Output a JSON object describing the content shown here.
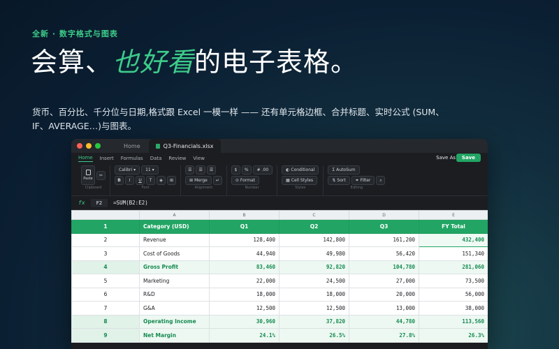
{
  "hero": {
    "kicker": "全新 · 数字格式与图表",
    "headline_prefix": "会算、",
    "headline_accent": "也好看",
    "headline_suffix": "的电子表格。",
    "description": "货币、百分比、千分位与日期,格式跟 Excel 一模一样 —— 还有单元格边框、合并标题、实时公式 (SUM、IF、AVERAGE…)与图表。"
  },
  "window": {
    "tab_home": "Home",
    "tab_file": "Q3-Financials.xlsx",
    "menus": [
      "Home",
      "Insert",
      "Formulas",
      "Data",
      "Review",
      "View"
    ],
    "save_as": "Save As",
    "save": "Save"
  },
  "ribbon": {
    "paste": "Paste",
    "clipboard": "Clipboard",
    "font_name": "Calibri ▾",
    "font_size": "11 ▾",
    "font_buttons": [
      "B",
      "I",
      "U",
      "T",
      "◈",
      "⊞"
    ],
    "font": "Font",
    "merge": "Merge",
    "alignment": "Alignment",
    "format": "Format",
    "number": "Number",
    "currency": "$",
    "percent": "%",
    "decimals": ".00",
    "conditional": "Conditional",
    "cell_styles": "Cell Styles",
    "styles": "Styles",
    "autosum": "AutoSum",
    "sort": "Sort",
    "filter": "Filter",
    "editing": "Editing"
  },
  "formula_bar": {
    "fx": "fx",
    "cell_ref": "F2",
    "formula": "=SUM(B2:E2)"
  },
  "sheet": {
    "columns": [
      "A",
      "B",
      "C",
      "D",
      "E"
    ],
    "rows": [
      {
        "n": "1",
        "cells": [
          "Category (USD)",
          "Q1",
          "Q2",
          "Q3",
          "FY Total"
        ]
      },
      {
        "n": "2",
        "cells": [
          "Revenue",
          "128,400",
          "142,800",
          "161,200",
          "432,400"
        ]
      },
      {
        "n": "3",
        "cells": [
          "Cost of Goods",
          "44,940",
          "49,980",
          "56,420",
          "151,340"
        ]
      },
      {
        "n": "4",
        "cells": [
          "Gross Profit",
          "83,460",
          "92,820",
          "104,780",
          "281,060"
        ]
      },
      {
        "n": "5",
        "cells": [
          "Marketing",
          "22,000",
          "24,500",
          "27,000",
          "73,500"
        ]
      },
      {
        "n": "6",
        "cells": [
          "R&D",
          "18,000",
          "18,000",
          "20,000",
          "56,000"
        ]
      },
      {
        "n": "7",
        "cells": [
          "G&A",
          "12,500",
          "12,500",
          "13,000",
          "38,000"
        ]
      },
      {
        "n": "8",
        "cells": [
          "Operating Income",
          "30,960",
          "37,820",
          "44,780",
          "113,560"
        ]
      },
      {
        "n": "9",
        "cells": [
          "Net Margin",
          "24.1%",
          "26.5%",
          "27.8%",
          "26.3%"
        ]
      }
    ]
  },
  "colors": {
    "accent": "#3dcc8a",
    "header_green": "#22a564",
    "bold_row_text": "#168a52"
  }
}
